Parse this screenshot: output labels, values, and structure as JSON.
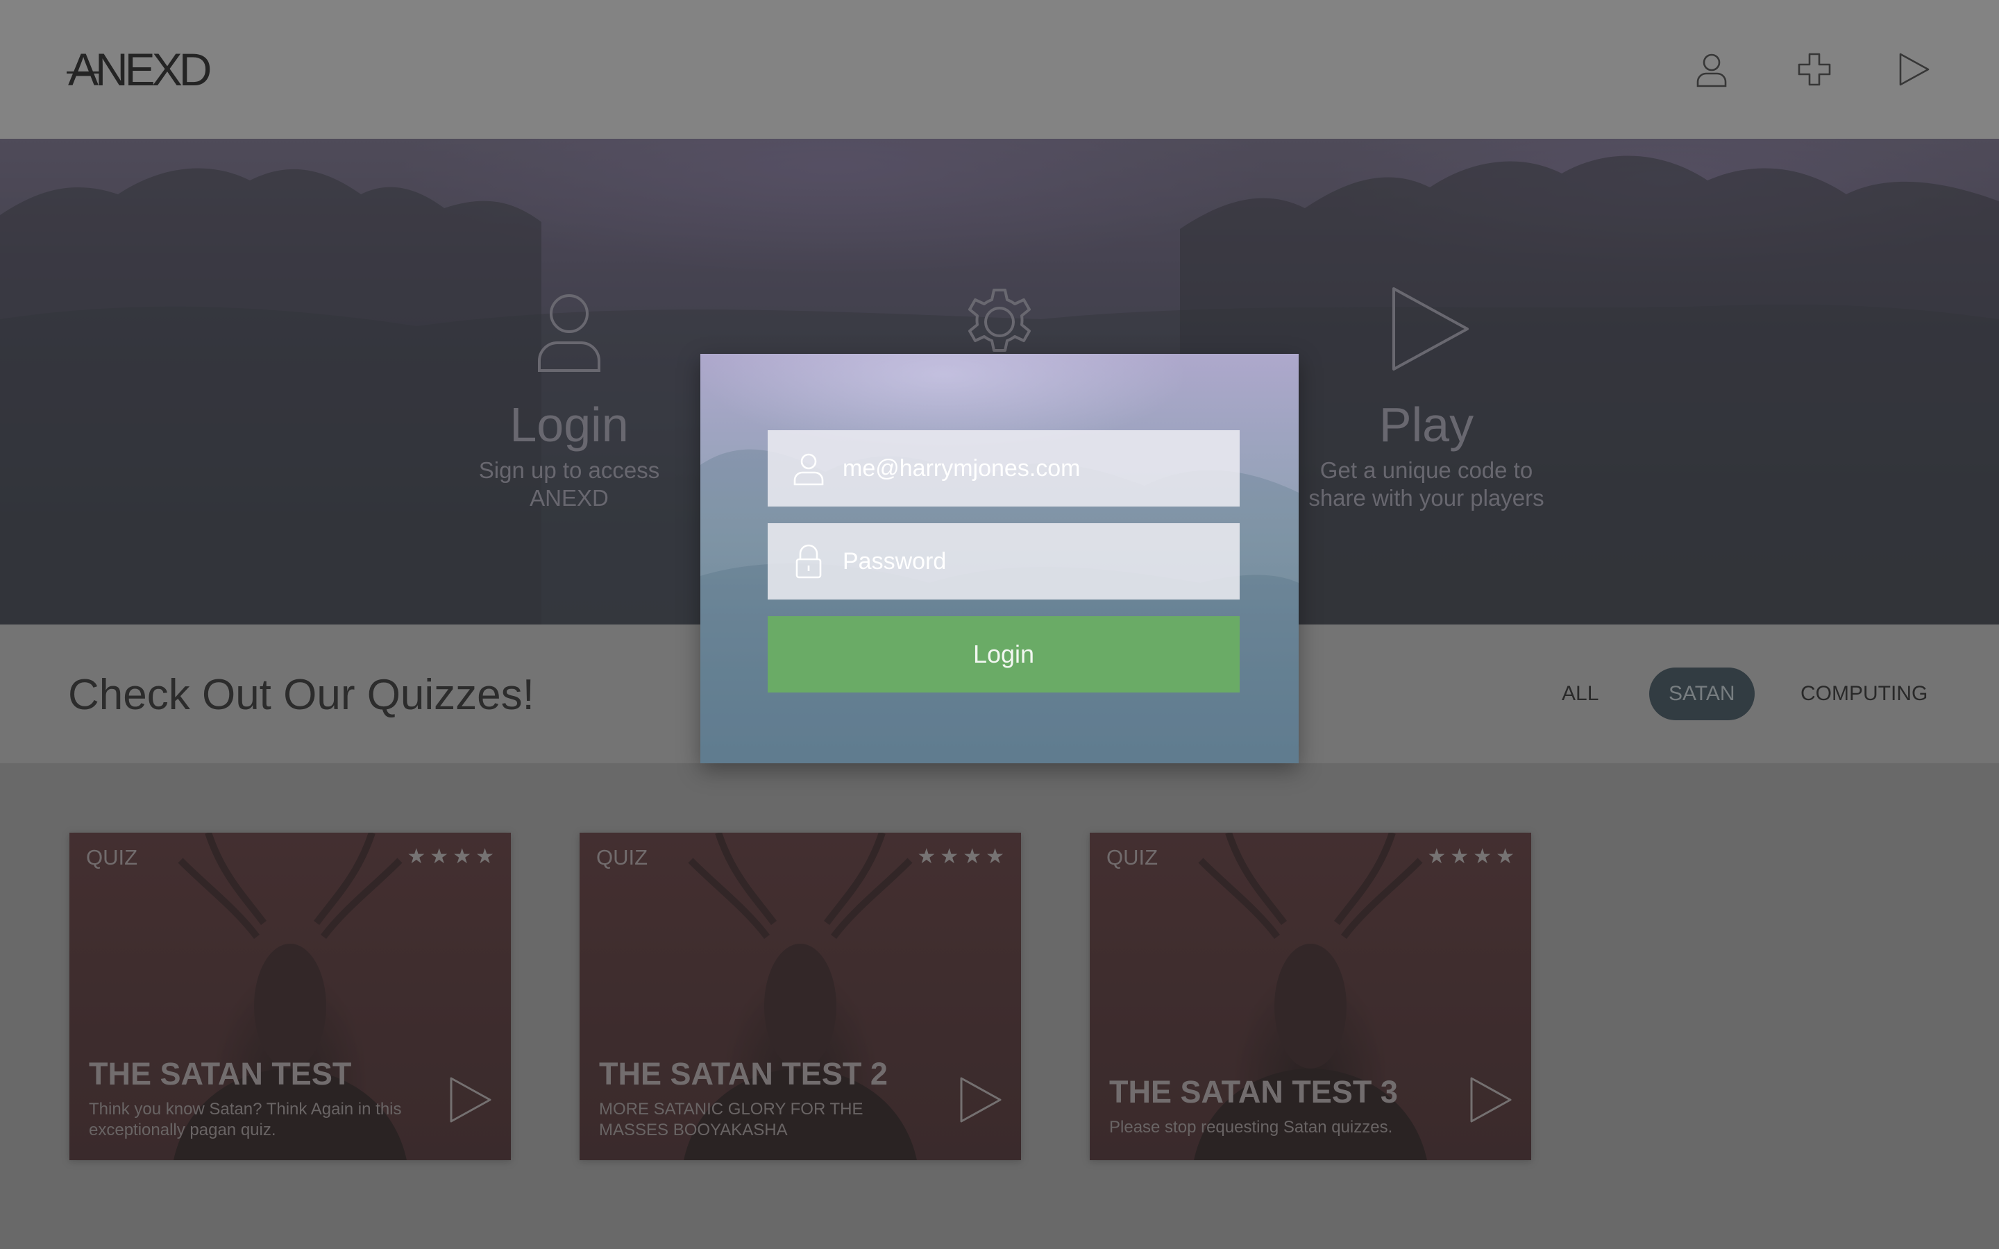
{
  "header": {
    "logo": "ANEXD",
    "icons": [
      "user-icon",
      "plus-icon",
      "play-icon"
    ]
  },
  "hero": {
    "features": [
      {
        "icon": "user-icon",
        "title": "Login",
        "description": "Sign up to access ANEXD"
      },
      {
        "icon": "gear-icon",
        "title": "",
        "description": ""
      },
      {
        "icon": "play-icon",
        "title": "Play",
        "description": "Get a unique code to share with your players"
      }
    ]
  },
  "section": {
    "title": "Check Out Our Quizzes!",
    "filters": [
      {
        "label": "ALL",
        "active": false
      },
      {
        "label": "SATAN",
        "active": true
      },
      {
        "label": "COMPUTING",
        "active": false
      }
    ]
  },
  "quizzes": [
    {
      "tag": "QUIZ",
      "rating": 4,
      "title": "THE SATAN TEST",
      "description": "Think you know Satan? Think Again in this exceptionally pagan quiz."
    },
    {
      "tag": "QUIZ",
      "rating": 4,
      "title": "THE SATAN TEST 2",
      "description": "MORE SATANIC GLORY FOR THE MASSES BOOYAKASHA"
    },
    {
      "tag": "QUIZ",
      "rating": 4,
      "title": "THE SATAN TEST 3",
      "description": "Please stop requesting Satan quizzes."
    }
  ],
  "login_modal": {
    "email_value": "me@harrymjones.com",
    "password_placeholder": "Password",
    "submit_label": "Login"
  },
  "colors": {
    "login_button": "#6aab66",
    "active_filter": "#2b3d47",
    "card_background": "#4a2628"
  }
}
